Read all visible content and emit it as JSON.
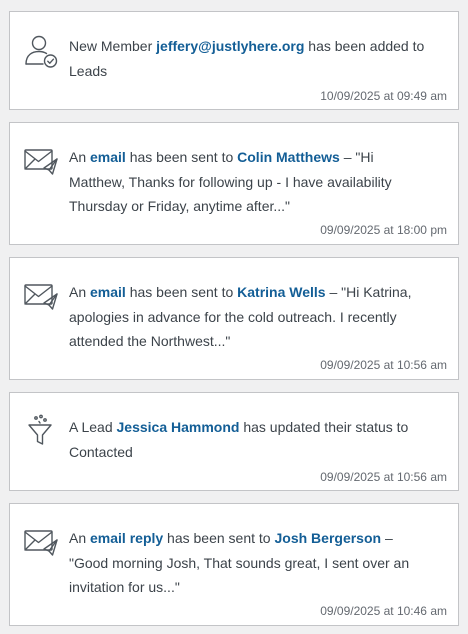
{
  "activities": [
    {
      "icon": "member-added-icon",
      "parts": [
        {
          "text": "New Member "
        },
        {
          "text": "jeffery@justlyhere.org",
          "link": true
        },
        {
          "text": " has been added to Leads"
        }
      ],
      "timestamp": "10/09/2025 at 09:49 am"
    },
    {
      "icon": "email-sent-icon",
      "parts": [
        {
          "text": "An "
        },
        {
          "text": "email",
          "link": true
        },
        {
          "text": " has been sent to "
        },
        {
          "text": "Colin Matthews",
          "link": true
        },
        {
          "text": " – \"Hi Matthew, Thanks for following up - I have availability Thursday or Friday, anytime after...\""
        }
      ],
      "timestamp": "09/09/2025 at 18:00 pm"
    },
    {
      "icon": "email-sent-icon",
      "parts": [
        {
          "text": "An "
        },
        {
          "text": "email",
          "link": true
        },
        {
          "text": " has been sent to "
        },
        {
          "text": "Katrina Wells",
          "link": true
        },
        {
          "text": " – \"Hi Katrina, apologies in advance for the cold outreach. I recently attended the Northwest...\""
        }
      ],
      "timestamp": "09/09/2025 at 10:56 am"
    },
    {
      "icon": "funnel-status-icon",
      "parts": [
        {
          "text": "A Lead "
        },
        {
          "text": "Jessica Hammond",
          "link": true
        },
        {
          "text": " has updated their status to Contacted"
        }
      ],
      "timestamp": "09/09/2025 at 10:56 am"
    },
    {
      "icon": "email-sent-icon",
      "parts": [
        {
          "text": "An "
        },
        {
          "text": "email reply",
          "link": true
        },
        {
          "text": " has been sent to "
        },
        {
          "text": "Josh Bergerson",
          "link": true
        },
        {
          "text": " – \"Good morning Josh, That sounds great, I sent over an invitation for us...\""
        }
      ],
      "timestamp": "09/09/2025 at 10:46 am"
    }
  ],
  "colors": {
    "link": "#135e96",
    "text": "#3c434a",
    "muted": "#646970",
    "border": "#c3c4c7",
    "background": "#f0f0f1"
  }
}
